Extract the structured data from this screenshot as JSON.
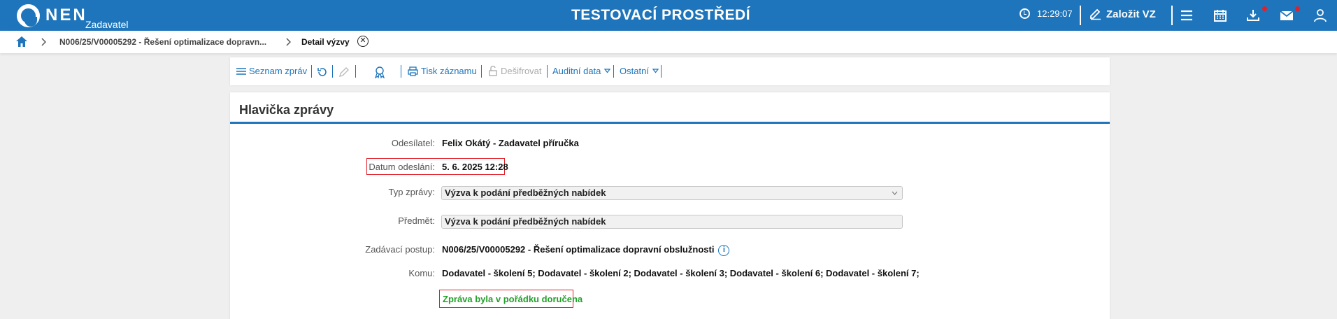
{
  "header": {
    "logo_text": "NEN",
    "logo_sub": "Zadavatel",
    "env_title": "TESTOVACÍ PROSTŘEDÍ",
    "clock": "12:29:07",
    "create_label": "Založit VZ",
    "accent": "#1e75bb"
  },
  "breadcrumb": {
    "items": [
      {
        "label": "N006/25/V00005292 - Řešení optimalizace dopravn..."
      },
      {
        "label": "Detail výzvy"
      }
    ]
  },
  "toolbar": {
    "items": [
      {
        "label": "Seznam zpráv"
      },
      {
        "label": "Tisk záznamu"
      },
      {
        "label": "Dešifrovat"
      },
      {
        "label": "Auditní data"
      },
      {
        "label": "Ostatní"
      }
    ]
  },
  "panel": {
    "title": "Hlavička zprávy",
    "fields": [
      {
        "label": "Odesílatel:",
        "value": "Felix Okátý - Zadavatel příručka"
      },
      {
        "label": "Datum odeslání:",
        "value": "5. 6. 2025 12:28"
      },
      {
        "label": "Typ zprávy:",
        "value": "Výzva k podání předběžných nabídek"
      },
      {
        "label": "Předmět:",
        "value": "Výzva k podání předběžných nabídek"
      },
      {
        "label": "Zadávací postup:",
        "value": "N006/25/V00005292 - Řešení optimalizace dopravní obslužnosti"
      },
      {
        "label": "Komu:",
        "value": "Dodavatel - školení 5; Dodavatel - školení 2; Dodavatel - školení 3; Dodavatel - školení 6; Dodavatel - školení 7;"
      }
    ],
    "status": "Zpráva byla v pořádku doručena",
    "status_color": "#22a02a",
    "highlight_color": "#e2202a"
  }
}
